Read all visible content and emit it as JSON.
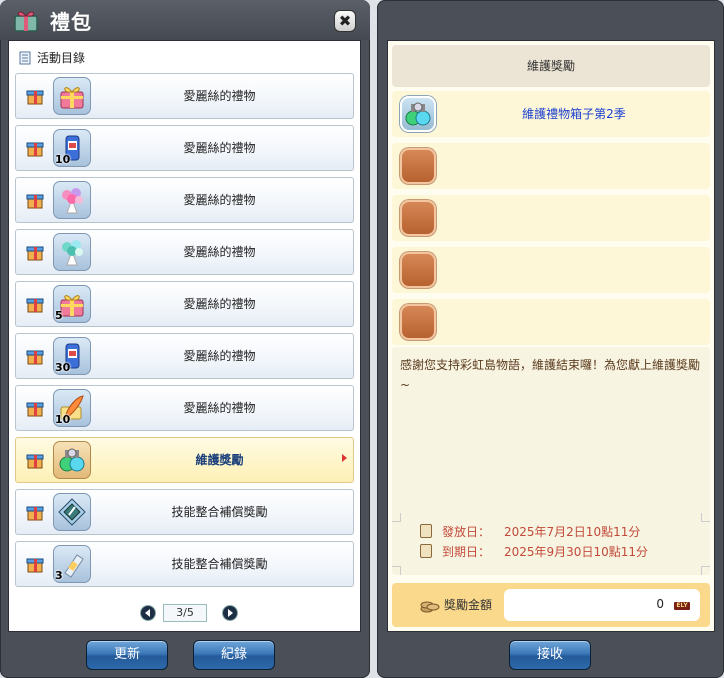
{
  "left_window": {
    "title": "禮包",
    "close_label": "✖",
    "events_header": "活動目錄",
    "events": [
      {
        "label": "愛麗絲的禮物",
        "qty": "",
        "art": "gift-box",
        "selected": false
      },
      {
        "label": "愛麗絲的禮物",
        "qty": "10",
        "art": "drink-can",
        "selected": false
      },
      {
        "label": "愛麗絲的禮物",
        "qty": "",
        "art": "flower-bouquet",
        "selected": false
      },
      {
        "label": "愛麗絲的禮物",
        "qty": "",
        "art": "teal-bouquet",
        "selected": false
      },
      {
        "label": "愛麗絲的禮物",
        "qty": "5",
        "art": "gift-box",
        "selected": false
      },
      {
        "label": "愛麗絲的禮物",
        "qty": "30",
        "art": "drink-can",
        "selected": false
      },
      {
        "label": "愛麗絲的禮物",
        "qty": "10",
        "art": "feather-scroll",
        "selected": false
      },
      {
        "label": "維護獎勵",
        "qty": "",
        "art": "potion-bundle",
        "selected": true
      },
      {
        "label": "技能整合補償獎勵",
        "qty": "",
        "art": "crystal-card",
        "selected": false
      },
      {
        "label": "技能整合補償獎勵",
        "qty": "3",
        "art": "potion-bottle",
        "selected": false
      }
    ],
    "pager": {
      "text": "3/5"
    },
    "refresh_label": "更新",
    "record_label": "紀錄"
  },
  "right_window": {
    "header": "維護獎勵",
    "items": [
      {
        "name": "維護禮物箱子第2季",
        "filled": true
      },
      {
        "name": "",
        "filled": false
      },
      {
        "name": "",
        "filled": false
      },
      {
        "name": "",
        "filled": false
      },
      {
        "name": "",
        "filled": false
      }
    ],
    "message": "感謝您支持彩虹島物語，維護結束囉！為您獻上維護獎勵~",
    "issue_label": "發放日：",
    "issue_date": "2025年7月2日10點11分",
    "expire_label": "到期日：",
    "expire_date": "2025年9月30日10點11分",
    "amount_label": "獎勵金額",
    "amount_value": "0",
    "currency_symbol": "ELY",
    "receive_label": "接收"
  },
  "colors": {
    "window_frame": "#4b5058",
    "button_blue": "#3c78b8",
    "selected_row": "#fdf0b5",
    "item_name": "#1a3fd0",
    "date_text": "#c24a3a",
    "amount_bar": "#fbd98c"
  }
}
